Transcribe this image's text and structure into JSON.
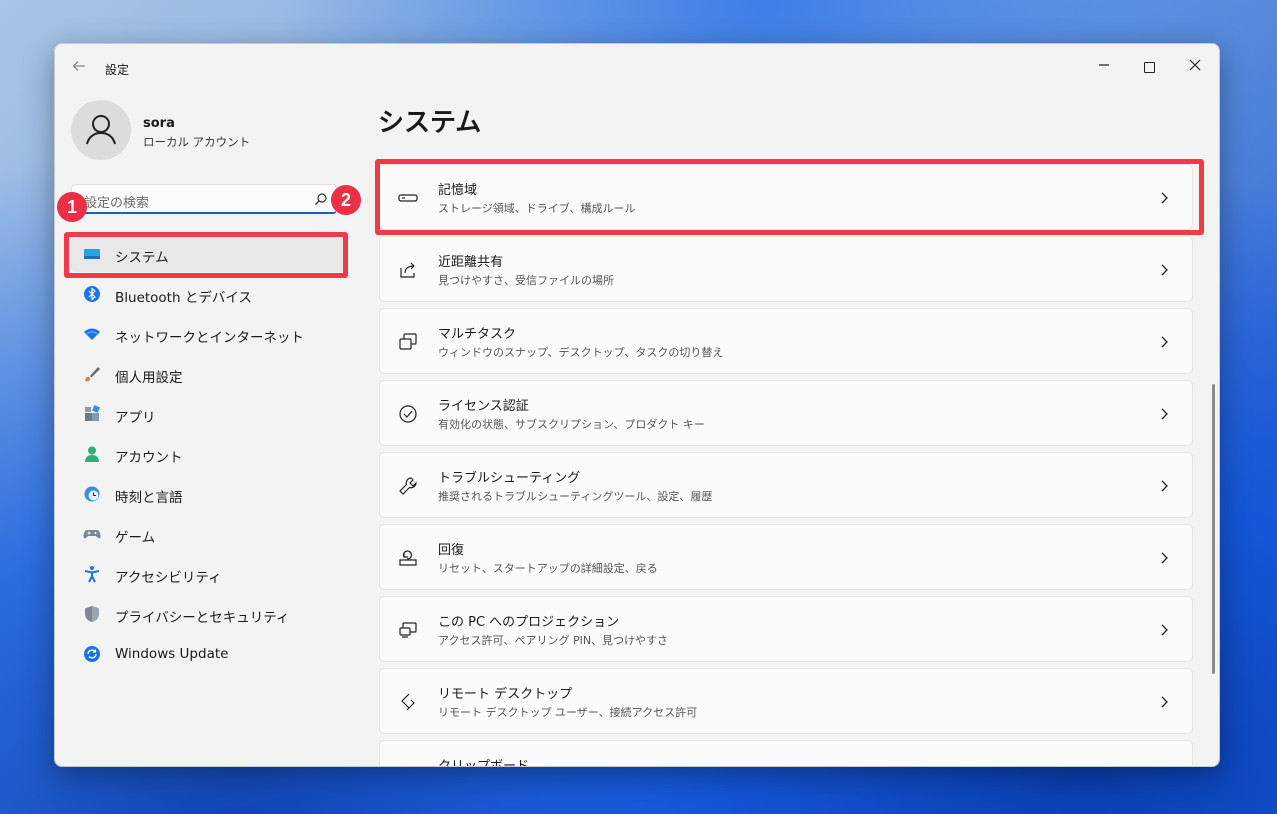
{
  "window": {
    "title": "設定"
  },
  "user": {
    "name": "sora",
    "account_type": "ローカル アカウント"
  },
  "search": {
    "placeholder": "設定の検索"
  },
  "nav": {
    "items": [
      {
        "label": "システム",
        "icon": "system-display-icon",
        "selected": true
      },
      {
        "label": "Bluetooth とデバイス",
        "icon": "bluetooth-icon"
      },
      {
        "label": "ネットワークとインターネット",
        "icon": "wifi-icon"
      },
      {
        "label": "個人用設定",
        "icon": "brush-icon"
      },
      {
        "label": "アプリ",
        "icon": "apps-icon"
      },
      {
        "label": "アカウント",
        "icon": "account-icon"
      },
      {
        "label": "時刻と言語",
        "icon": "clock-globe-icon"
      },
      {
        "label": "ゲーム",
        "icon": "gamepad-icon"
      },
      {
        "label": "アクセシビリティ",
        "icon": "accessibility-icon"
      },
      {
        "label": "プライバシーとセキュリティ",
        "icon": "shield-icon"
      },
      {
        "label": "Windows Update",
        "icon": "update-icon"
      }
    ]
  },
  "main": {
    "title": "システム",
    "cards": [
      {
        "title": "記憶域",
        "subtitle": "ストレージ領域、ドライブ、構成ルール",
        "icon": "storage-icon"
      },
      {
        "title": "近距離共有",
        "subtitle": "見つけやすさ、受信ファイルの場所",
        "icon": "share-icon"
      },
      {
        "title": "マルチタスク",
        "subtitle": "ウィンドウのスナップ、デスクトップ、タスクの切り替え",
        "icon": "multitask-icon"
      },
      {
        "title": "ライセンス認証",
        "subtitle": "有効化の状態、サブスクリプション、プロダクト キー",
        "icon": "check-circle-icon"
      },
      {
        "title": "トラブルシューティング",
        "subtitle": "推奨されるトラブルシューティングツール、設定、履歴",
        "icon": "wrench-icon"
      },
      {
        "title": "回復",
        "subtitle": "リセット、スタートアップの詳細設定、戻る",
        "icon": "recovery-icon"
      },
      {
        "title": "この PC へのプロジェクション",
        "subtitle": "アクセス許可、ペアリング PIN、見つけやすさ",
        "icon": "projection-icon"
      },
      {
        "title": "リモート デスクトップ",
        "subtitle": "リモート デスクトップ ユーザー、接続アクセス許可",
        "icon": "remote-desktop-icon"
      },
      {
        "title": "クリップボード",
        "subtitle": "",
        "icon": "clipboard-icon"
      }
    ]
  },
  "annotations": {
    "badge1": "1",
    "badge2": "2",
    "color": "#f03a4c"
  },
  "colors": {
    "accent": "#1565c0",
    "highlight": "#f03a4c"
  }
}
